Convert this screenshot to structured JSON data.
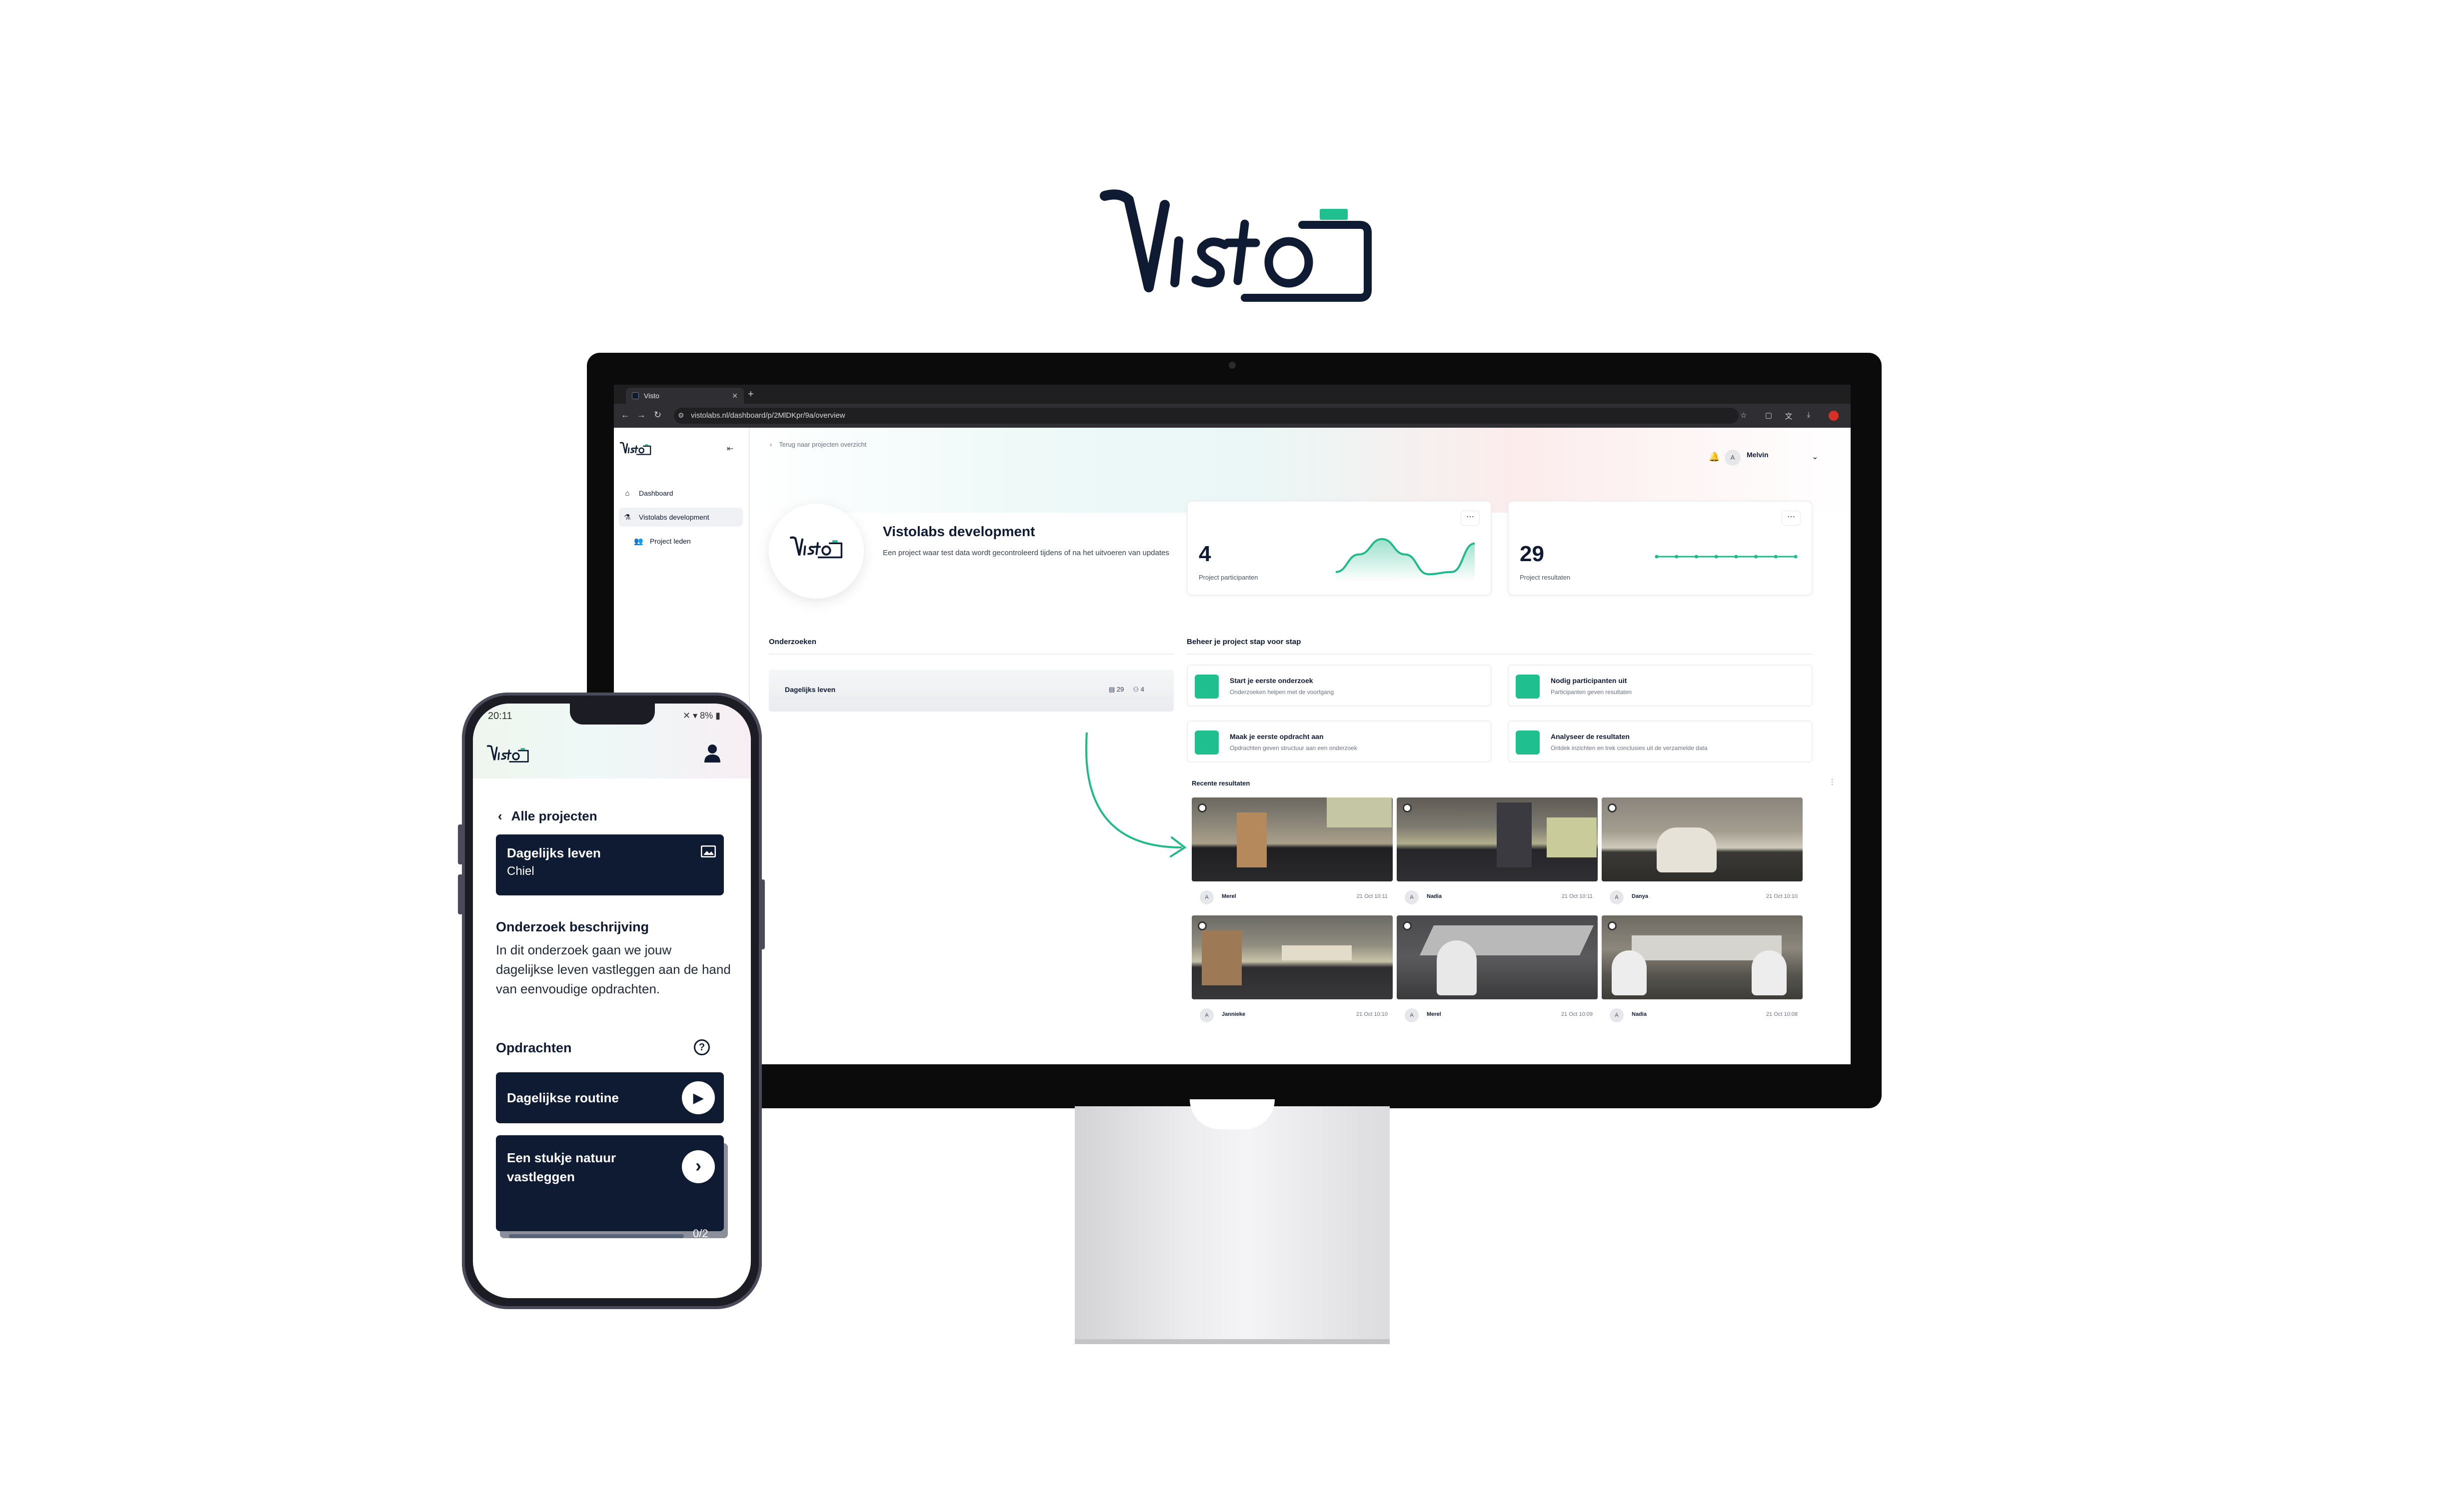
{
  "colors": {
    "navy": "#0f1b33",
    "accent_green": "#1fbf8f",
    "chart_line": "#22b98a"
  },
  "browser": {
    "tab_title": "Visto",
    "url": "vistolabs.nl/dashboard/p/2MlDKpr/9a/overview"
  },
  "sidebar": {
    "items": [
      {
        "label": "Dashboard",
        "icon": "home-icon"
      },
      {
        "label": "Vistolabs development",
        "icon": "flask-icon"
      },
      {
        "label": "Project leden",
        "icon": "users-icon"
      }
    ]
  },
  "header": {
    "back_link": "Terug naar projecten overzicht",
    "user_name": "Melvin",
    "user_avatar": "A"
  },
  "project": {
    "title": "Vistolabs development",
    "description": "Een project waar test data wordt gecontroleerd tijdens of na het uitvoeren van updates"
  },
  "stats": [
    {
      "value": "4",
      "label": "Project participanten",
      "trend": [
        0.15,
        0.55,
        0.9,
        0.55,
        0.1,
        0.15,
        0.8
      ]
    },
    {
      "value": "29",
      "label": "Project resultaten",
      "trend": [
        0.5,
        0.5,
        0.5,
        0.5,
        0.5,
        0.5,
        0.5,
        0.5
      ]
    }
  ],
  "onderzoeken": {
    "title": "Onderzoeken",
    "items": [
      {
        "name": "Dagelijks leven",
        "results": "29",
        "participants": "4"
      }
    ]
  },
  "steps": {
    "title": "Beheer je project stap voor stap",
    "items": [
      {
        "title": "Start je eerste onderzoek",
        "subtitle": "Onderzoeken helpen met de voortgang"
      },
      {
        "title": "Nodig participanten uit",
        "subtitle": "Participanten geven resultaten"
      },
      {
        "title": "Maak je eerste opdracht aan",
        "subtitle": "Opdrachten geven structuur aan een onderzoek"
      },
      {
        "title": "Analyseer de resultaten",
        "subtitle": "Ontdek inzichten en trek conclusies uit de verzamelde data"
      }
    ]
  },
  "recent": {
    "title": "Recente resultaten",
    "items": [
      {
        "name": "Merel",
        "date": "21 Oct",
        "time": "10:11"
      },
      {
        "name": "Nadia",
        "date": "21 Oct",
        "time": "10:11"
      },
      {
        "name": "Danya",
        "date": "21 Oct",
        "time": "10:10"
      },
      {
        "name": "Jannieke",
        "date": "21 Oct",
        "time": "10:10"
      },
      {
        "name": "Merel",
        "date": "21 Oct",
        "time": "10:09"
      },
      {
        "name": "Nadia",
        "date": "21 Oct",
        "time": "10:08"
      }
    ]
  },
  "phone": {
    "time": "20:11",
    "status": "✕ ▾ 8% ▮",
    "back_label": "Alle projecten",
    "study_title": "Dagelijks leven",
    "study_owner": "Chiel",
    "desc_title": "Onderzoek beschrijving",
    "desc": "In dit onderzoek gaan we jouw dagelijkse leven vastleggen aan de hand van eenvoudige opdrachten.",
    "tasks_title": "Opdrachten",
    "help": "?",
    "tasks": [
      {
        "title": "Dagelijkse routine",
        "icon": "play-icon"
      },
      {
        "title": "Een stukje natuur vastleggen",
        "icon": "chevron-right-icon",
        "progress": "0/2",
        "progress_fraction": 0
      }
    ]
  }
}
